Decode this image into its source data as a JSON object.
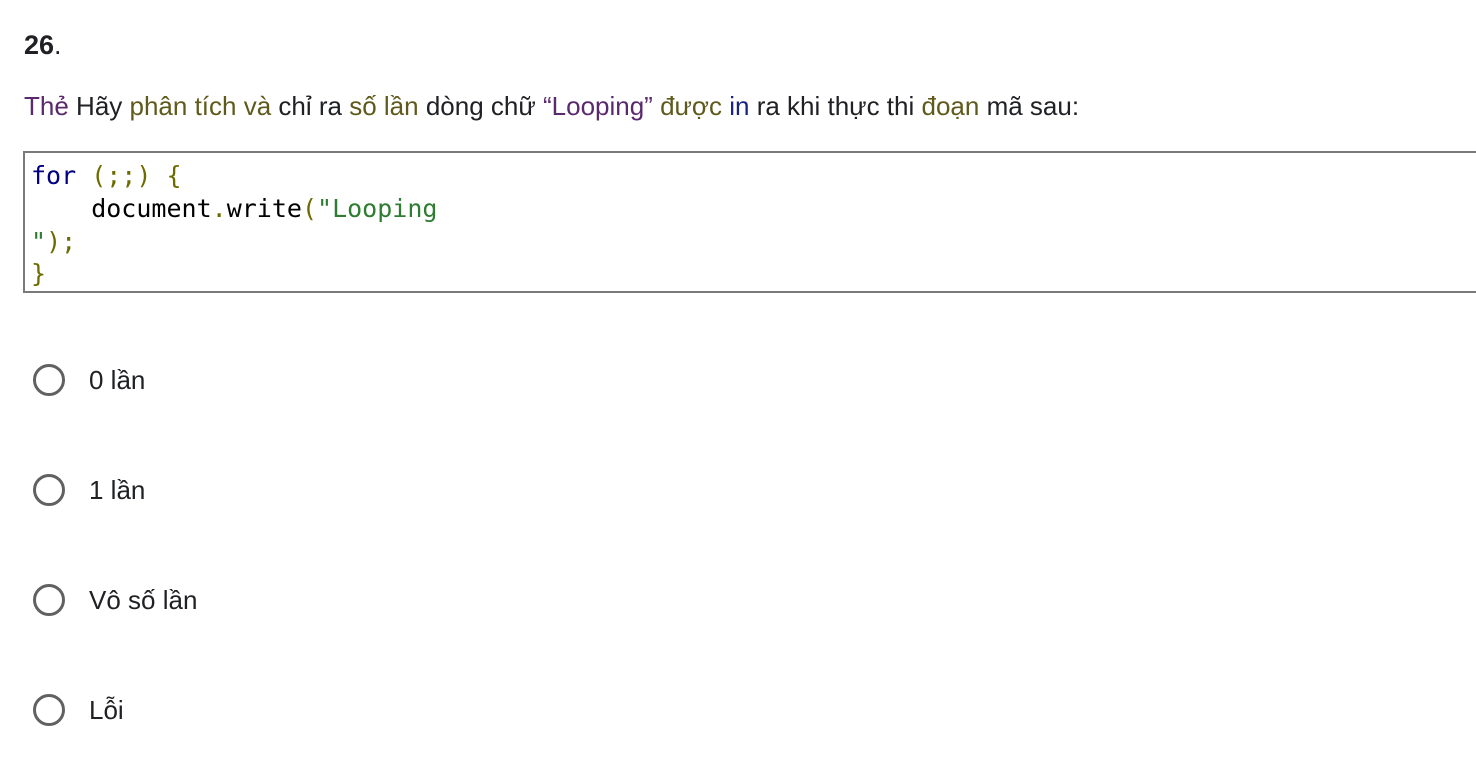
{
  "question": {
    "number": "26",
    "number_suffix": ".",
    "text_parts": [
      {
        "text": "Thẻ",
        "color": "#5b2a6e"
      },
      {
        "text": " Hãy ",
        "color": "#202124"
      },
      {
        "text": "phân tích",
        "color": "#5f5a1c"
      },
      {
        "text": " ",
        "color": "#202124"
      },
      {
        "text": "và",
        "color": "#5f5a1c"
      },
      {
        "text": " chỉ ",
        "color": "#202124"
      },
      {
        "text": "ra",
        "color": "#202124"
      },
      {
        "text": " số lần ",
        "color": "#5f5a1c"
      },
      {
        "text": "dòng chữ ",
        "color": "#202124"
      },
      {
        "text": "“Looping”",
        "color": "#5b2a6e"
      },
      {
        "text": " được ",
        "color": "#5f5a1c"
      },
      {
        "text": "in",
        "color": "#1a237e"
      },
      {
        "text": " ra khi thực thi ",
        "color": "#202124"
      },
      {
        "text": "đoạn",
        "color": "#5f5a1c"
      },
      {
        "text": " mã ",
        "color": "#202124"
      },
      {
        "text": "sau:",
        "color": "#202124"
      }
    ]
  },
  "code": {
    "lines": [
      [
        {
          "text": "for",
          "class": "c-kw"
        },
        {
          "text": " (;;) {",
          "class": "c-punct"
        }
      ],
      [
        {
          "text": "    document",
          "class": "c-ident"
        },
        {
          "text": ".",
          "class": "c-punct"
        },
        {
          "text": "write",
          "class": "c-ident"
        },
        {
          "text": "(",
          "class": "c-punct"
        },
        {
          "text": "\"Looping",
          "class": "c-str"
        }
      ],
      [
        {
          "text": "\"",
          "class": "c-str"
        },
        {
          "text": ");",
          "class": "c-punct"
        }
      ],
      [
        {
          "text": "}",
          "class": "c-punct"
        }
      ]
    ]
  },
  "options": [
    {
      "label": "0 lần",
      "selected": false
    },
    {
      "label": "1 lần",
      "selected": false
    },
    {
      "label": "Vô số lần",
      "selected": false
    },
    {
      "label": "Lỗi",
      "selected": false
    }
  ]
}
